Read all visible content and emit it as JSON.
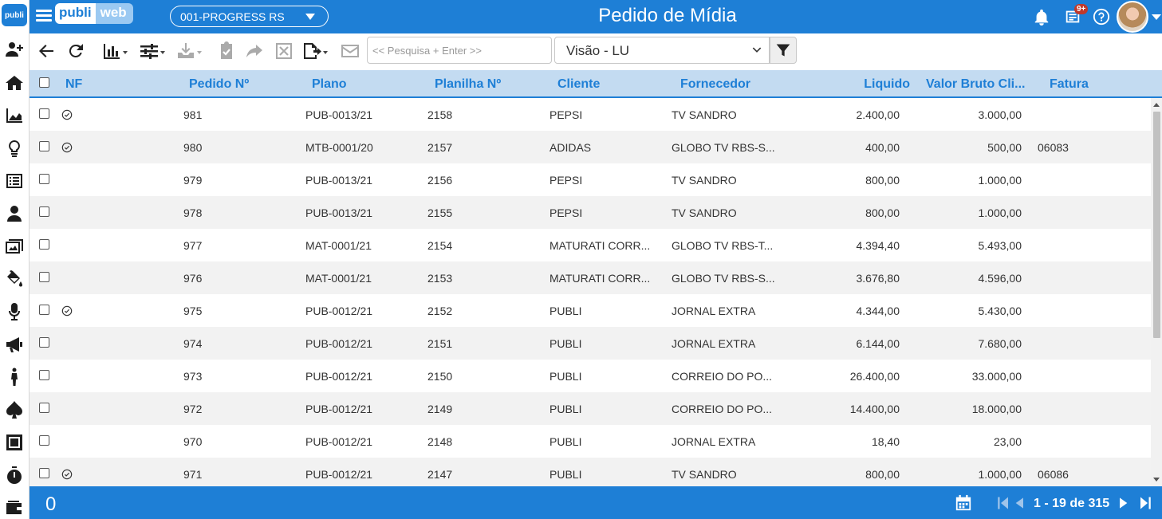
{
  "app": {
    "logo_text": "publi",
    "brand_part1": "publi",
    "brand_part2": "web",
    "company": "001-PROGRESS RS",
    "page_title": "Pedido de Mídia",
    "notification_badge": "9+"
  },
  "sidebar": {
    "icons": [
      "add-user-icon",
      "home-icon",
      "area-chart-icon",
      "lightbulb-icon",
      "list-icon",
      "person-icon",
      "media-icon",
      "paint-bucket-icon",
      "microphone-icon",
      "megaphone-icon",
      "person-standing-icon",
      "spade-icon",
      "square-icon",
      "stopwatch-icon",
      "wallet-icon"
    ]
  },
  "toolbar": {
    "search_placeholder": "<< Pesquisa + Enter >>",
    "view_selected": "Visão - LU"
  },
  "grid": {
    "columns": {
      "nf": "NF",
      "pedido": "Pedido Nº",
      "plano": "Plano",
      "planilha": "Planilha Nº",
      "cliente": "Cliente",
      "fornecedor": "Fornecedor",
      "liquido": "Liquido",
      "valor_bruto": "Valor Bruto Cli...",
      "fatura": "Fatura"
    },
    "rows": [
      {
        "nf": true,
        "pedido": "981",
        "plano": "PUB-0013/21",
        "planilha": "2158",
        "cliente": "PEPSI",
        "fornecedor": "TV SANDRO",
        "liquido": "2.400,00",
        "valor_bruto": "3.000,00",
        "fatura": ""
      },
      {
        "nf": true,
        "pedido": "980",
        "plano": "MTB-0001/20",
        "planilha": "2157",
        "cliente": "ADIDAS",
        "fornecedor": "GLOBO TV RBS-S...",
        "liquido": "400,00",
        "valor_bruto": "500,00",
        "fatura": "06083"
      },
      {
        "nf": false,
        "pedido": "979",
        "plano": "PUB-0013/21",
        "planilha": "2156",
        "cliente": "PEPSI",
        "fornecedor": "TV SANDRO",
        "liquido": "800,00",
        "valor_bruto": "1.000,00",
        "fatura": ""
      },
      {
        "nf": false,
        "pedido": "978",
        "plano": "PUB-0013/21",
        "planilha": "2155",
        "cliente": "PEPSI",
        "fornecedor": "TV SANDRO",
        "liquido": "800,00",
        "valor_bruto": "1.000,00",
        "fatura": ""
      },
      {
        "nf": false,
        "pedido": "977",
        "plano": "MAT-0001/21",
        "planilha": "2154",
        "cliente": "MATURATI CORR...",
        "fornecedor": "GLOBO TV RBS-T...",
        "liquido": "4.394,40",
        "valor_bruto": "5.493,00",
        "fatura": ""
      },
      {
        "nf": false,
        "pedido": "976",
        "plano": "MAT-0001/21",
        "planilha": "2153",
        "cliente": "MATURATI CORR...",
        "fornecedor": "GLOBO TV RBS-S...",
        "liquido": "3.676,80",
        "valor_bruto": "4.596,00",
        "fatura": ""
      },
      {
        "nf": true,
        "pedido": "975",
        "plano": "PUB-0012/21",
        "planilha": "2152",
        "cliente": "PUBLI",
        "fornecedor": "JORNAL EXTRA",
        "liquido": "4.344,00",
        "valor_bruto": "5.430,00",
        "fatura": ""
      },
      {
        "nf": false,
        "pedido": "974",
        "plano": "PUB-0012/21",
        "planilha": "2151",
        "cliente": "PUBLI",
        "fornecedor": "JORNAL EXTRA",
        "liquido": "6.144,00",
        "valor_bruto": "7.680,00",
        "fatura": ""
      },
      {
        "nf": false,
        "pedido": "973",
        "plano": "PUB-0012/21",
        "planilha": "2150",
        "cliente": "PUBLI",
        "fornecedor": "CORREIO DO PO...",
        "liquido": "26.400,00",
        "valor_bruto": "33.000,00",
        "fatura": ""
      },
      {
        "nf": false,
        "pedido": "972",
        "plano": "PUB-0012/21",
        "planilha": "2149",
        "cliente": "PUBLI",
        "fornecedor": "CORREIO DO PO...",
        "liquido": "14.400,00",
        "valor_bruto": "18.000,00",
        "fatura": ""
      },
      {
        "nf": false,
        "pedido": "970",
        "plano": "PUB-0012/21",
        "planilha": "2148",
        "cliente": "PUBLI",
        "fornecedor": "JORNAL EXTRA",
        "liquido": "18,40",
        "valor_bruto": "23,00",
        "fatura": ""
      },
      {
        "nf": true,
        "pedido": "971",
        "plano": "PUB-0012/21",
        "planilha": "2147",
        "cliente": "PUBLI",
        "fornecedor": "TV SANDRO",
        "liquido": "800,00",
        "valor_bruto": "1.000,00",
        "fatura": "06086"
      }
    ]
  },
  "footer": {
    "selected_count": "0",
    "pager": "1 - 19 de 315"
  },
  "colors": {
    "primary": "#1e7fd6",
    "header_bg": "#c3dbf1",
    "row_alt": "#f2f2f2"
  }
}
